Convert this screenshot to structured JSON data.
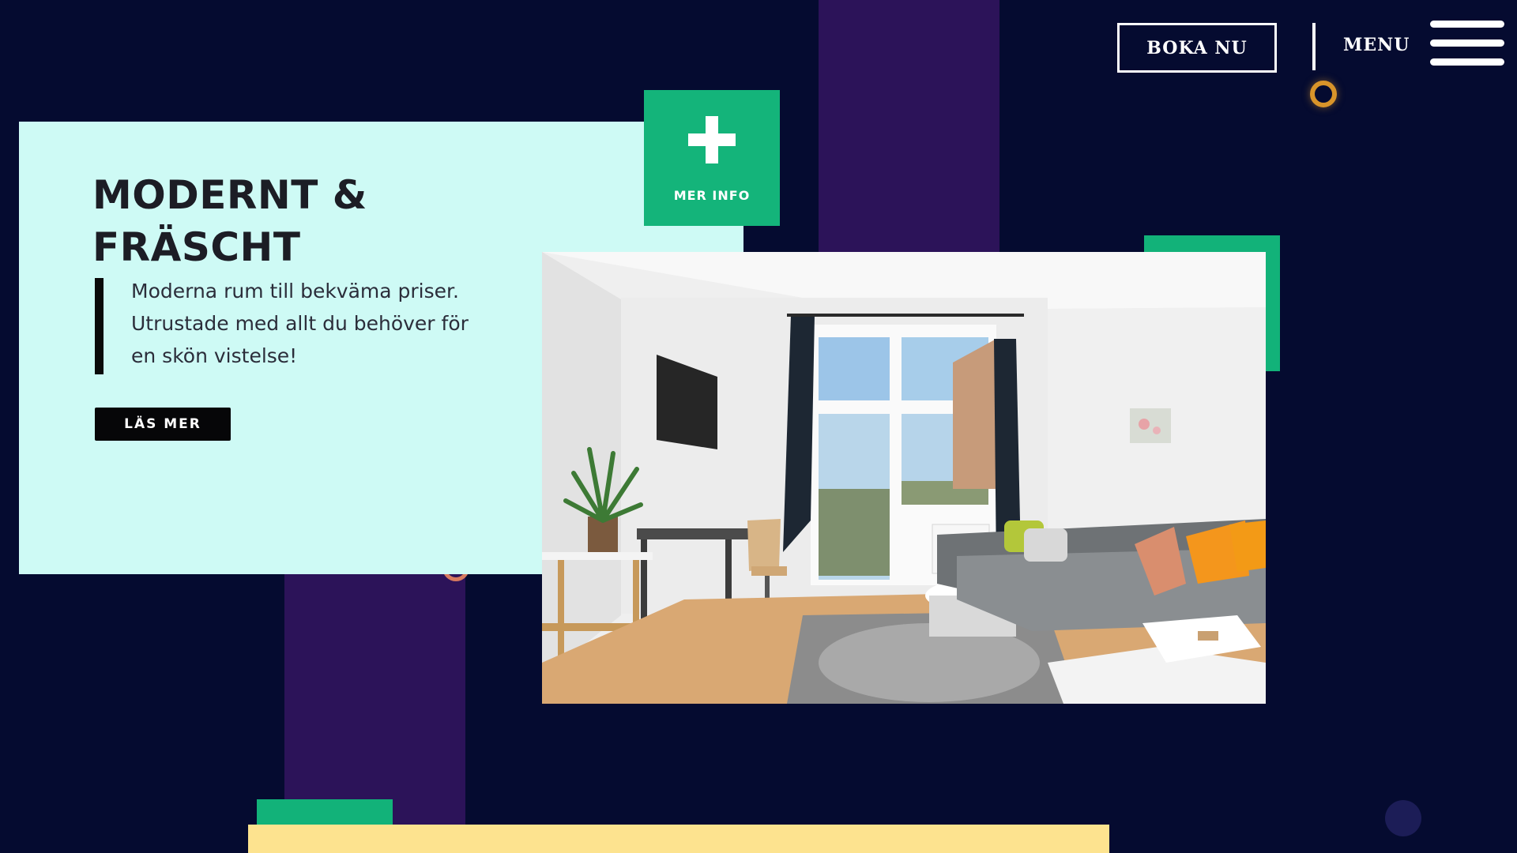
{
  "header": {
    "book_label": "BOKA NU",
    "menu_label": "MENU"
  },
  "hero": {
    "title": "MODERNT &\nFRÄSCHT",
    "description": "Moderna rum till bekväma priser. Utrustade med allt du behöver för en skön vistelse!",
    "read_more_label": "LÄS MER"
  },
  "more_info": {
    "label": "MER INFO",
    "icon": "plus-icon"
  },
  "photo": {
    "subject": "living room"
  },
  "colors": {
    "background": "#050b30",
    "stripe": "#2c1359",
    "card": "#cefaf5",
    "accent_green": "#14b47a",
    "accent_yellow": "#fde38f",
    "text_dark": "#1c1d25"
  }
}
